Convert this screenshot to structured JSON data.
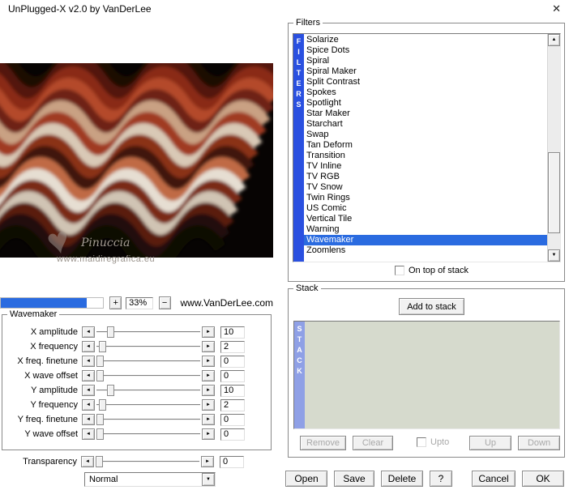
{
  "window": {
    "title": "UnPlugged-X v2.0 by VanDerLee"
  },
  "icons": {
    "close": "✕",
    "left_arrow": "◄",
    "right_arrow": "►",
    "up_arrow": "▲",
    "down_arrow": "▼",
    "dropdown_arrow": "▼",
    "heart": "♥"
  },
  "preview": {
    "zoom_in": "+",
    "zoom_out": "−",
    "zoom_value": "33%",
    "website": "www.VanDerLee.com",
    "watermark_name": "Pinuccia",
    "watermark_site": "www.maidiregrafica.eu",
    "progress_fraction": 0.84
  },
  "filters": {
    "group_label": "Filters",
    "vertical_label": [
      "F",
      "I",
      "L",
      "T",
      "E",
      "R",
      "S"
    ],
    "items": [
      "Solarize",
      "Spice Dots",
      "Spiral",
      "Spiral Maker",
      "Split Contrast",
      "Spokes",
      "Spotlight",
      "Star Maker",
      "Starchart",
      "Swap",
      "Tan Deform",
      "Transition",
      "TV Inline",
      "TV RGB",
      "TV Snow",
      "Twin Rings",
      "US Comic",
      "Vertical Tile",
      "Warning",
      "Wavemaker",
      "Zoomlens"
    ],
    "selected": "Wavemaker",
    "on_top_label": "On top of stack"
  },
  "wavemaker": {
    "group_label": "Wavemaker",
    "sliders": [
      {
        "label": "X amplitude",
        "value": "10",
        "pos": 0.1
      },
      {
        "label": "X frequency",
        "value": "2",
        "pos": 0.02
      },
      {
        "label": "X freq. finetune",
        "value": "0",
        "pos": 0.0
      },
      {
        "label": "X wave offset",
        "value": "0",
        "pos": 0.0
      },
      {
        "label": "Y amplitude",
        "value": "10",
        "pos": 0.1
      },
      {
        "label": "Y frequency",
        "value": "2",
        "pos": 0.02
      },
      {
        "label": "Y freq. finetune",
        "value": "0",
        "pos": 0.0
      },
      {
        "label": "Y wave offset",
        "value": "0",
        "pos": 0.0
      }
    ]
  },
  "transparency": {
    "label": "Transparency",
    "value": "0",
    "pos": 0.0
  },
  "blend": {
    "selected": "Normal"
  },
  "stack": {
    "group_label": "Stack",
    "vertical_label": [
      "S",
      "T",
      "A",
      "C",
      "K"
    ],
    "add_button": "Add to stack",
    "remove_button": "Remove",
    "clear_button": "Clear",
    "upto_label": "Upto",
    "up_button": "Up",
    "down_button": "Down"
  },
  "actions": {
    "open": "Open",
    "save": "Save",
    "delete": "Delete",
    "help": "?",
    "cancel": "Cancel",
    "ok": "OK"
  },
  "colors": {
    "selection": "#2a6be0",
    "filters_bar": "#2a50e0",
    "stack_bar": "#8fa0e6",
    "progress": "#2a6be0",
    "stack_bg": "#d6dacd"
  }
}
